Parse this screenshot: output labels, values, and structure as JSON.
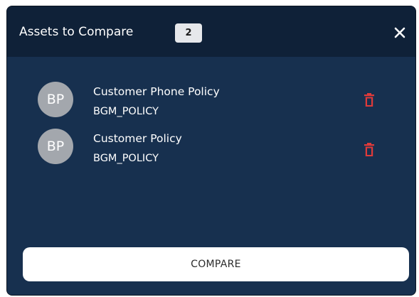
{
  "header": {
    "title": "Assets to Compare",
    "count": "2",
    "close_icon": "close-icon"
  },
  "assets": [
    {
      "avatar_initials": "BP",
      "name": "Customer Phone Policy",
      "code": "BGM_POLICY",
      "delete_icon": "trash-icon"
    },
    {
      "avatar_initials": "BP",
      "name": "Customer Policy",
      "code": "BGM_POLICY",
      "delete_icon": "trash-icon"
    }
  ],
  "footer": {
    "compare_label": "COMPARE"
  },
  "colors": {
    "panel_background": "#17304f",
    "header_background": "#0f2138",
    "delete_icon": "#e03a3a",
    "avatar": "#a3a7ad"
  }
}
